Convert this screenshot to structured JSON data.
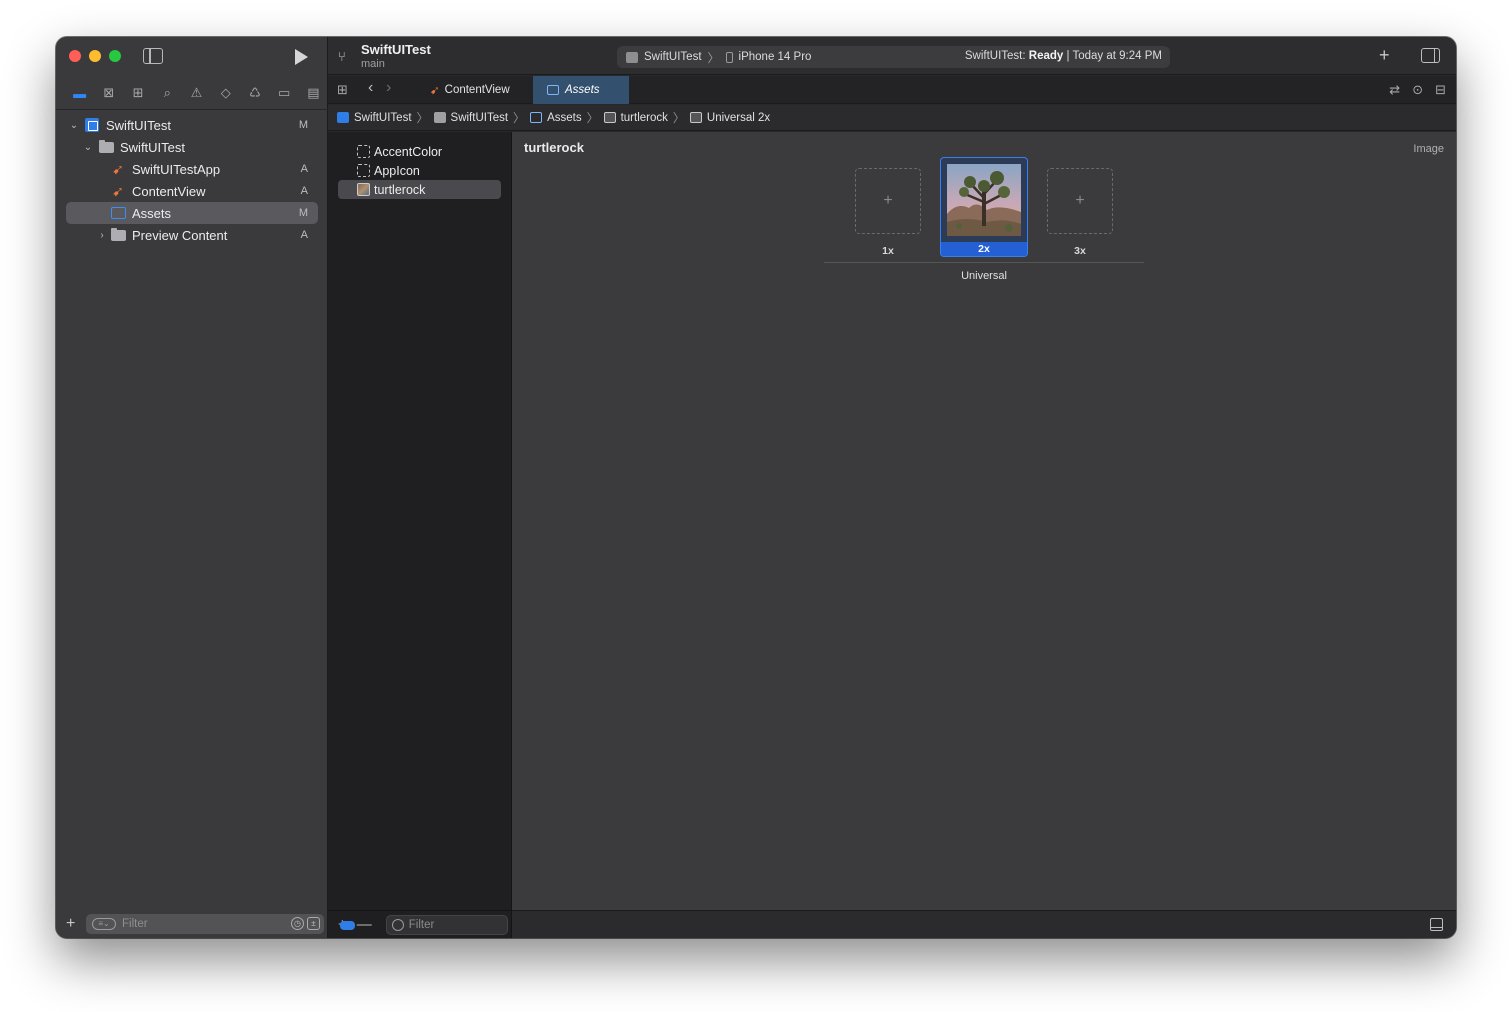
{
  "window": {
    "project_title": "SwiftUITest",
    "branch": "main"
  },
  "activity": {
    "scheme": "SwiftUITest",
    "device": "iPhone 14 Pro",
    "status_prefix": "SwiftUITest:",
    "status_state": "Ready",
    "status_time": "| Today at 9:24 PM"
  },
  "navigator": {
    "tree": [
      {
        "label": "SwiftUITest",
        "status": "M",
        "icon": "project-icon",
        "level": 0,
        "expanded": true
      },
      {
        "label": "SwiftUITest",
        "status": "",
        "icon": "folder-icon",
        "level": 1,
        "expanded": true
      },
      {
        "label": "SwiftUITestApp",
        "status": "A",
        "icon": "swift-file-icon",
        "level": 2
      },
      {
        "label": "ContentView",
        "status": "A",
        "icon": "swift-file-icon",
        "level": 2
      },
      {
        "label": "Assets",
        "status": "M",
        "icon": "asset-catalog-icon",
        "level": 2,
        "selected": true
      },
      {
        "label": "Preview Content",
        "status": "A",
        "icon": "folder-icon",
        "level": 2,
        "expanded": false
      }
    ],
    "filter_placeholder": "Filter"
  },
  "tabs": [
    {
      "label": "ContentView",
      "icon": "swift-file-icon"
    },
    {
      "label": "Assets",
      "icon": "asset-catalog-icon",
      "active": true
    }
  ],
  "breadcrumb": [
    "SwiftUITest",
    "SwiftUITest",
    "Assets",
    "turtlerock",
    "Universal 2x"
  ],
  "asset_list": {
    "items": [
      {
        "label": "AccentColor",
        "icon": "color-set-icon"
      },
      {
        "label": "AppIcon",
        "icon": "app-icon-set-icon"
      },
      {
        "label": "turtlerock",
        "icon": "image-set-icon",
        "selected": true
      }
    ],
    "filter_placeholder": "Filter",
    "add_label": "+",
    "remove_label": "—"
  },
  "editor": {
    "asset_name": "turtlerock",
    "asset_type": "Image",
    "slots": [
      {
        "label": "1x",
        "filled": false,
        "placeholder": "+"
      },
      {
        "label": "2x",
        "filled": true
      },
      {
        "label": "3x",
        "filled": false,
        "placeholder": "+"
      }
    ],
    "group_label": "Universal"
  },
  "colors": {
    "accent": "#2f7ee8",
    "close": "#ff5f57",
    "minimize": "#febc2e",
    "zoom": "#28c840",
    "swift": "#f0783c"
  }
}
